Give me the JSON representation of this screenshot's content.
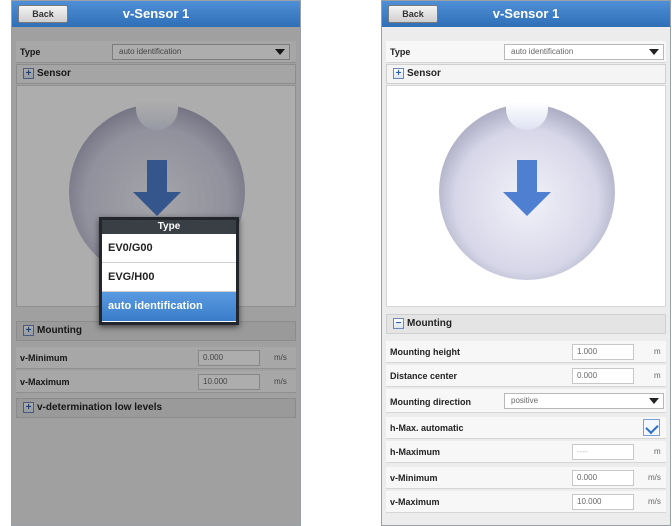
{
  "left": {
    "back_label": "Back",
    "title": "v-Sensor 1",
    "type_label": "Type",
    "type_value": "auto identification",
    "sensor_section": "Sensor",
    "mounting_section": "Mounting",
    "vmin_label": "v-Minimum",
    "vmin_value": "0.000",
    "vmin_unit": "m/s",
    "vmax_label": "v-Maximum",
    "vmax_value": "10.000",
    "vmax_unit": "m/s",
    "vlow_section": "v-determination low levels",
    "popup": {
      "title": "Type",
      "options": [
        "EV0/G00",
        "EVG/H00",
        "auto identification"
      ]
    }
  },
  "right": {
    "back_label": "Back",
    "title": "v-Sensor 1",
    "type_label": "Type",
    "type_value": "auto identification",
    "sensor_section": "Sensor",
    "mounting_section": "Mounting",
    "mounting_height_label": "Mounting height",
    "mounting_height_value": "1.000",
    "mounting_height_unit": "m",
    "distance_center_label": "Distance center",
    "distance_center_value": "0.000",
    "distance_center_unit": "m",
    "mounting_direction_label": "Mounting direction",
    "mounting_direction_value": "positive",
    "hmax_auto_label": "h-Max. automatic",
    "hmax_auto_checked": true,
    "hmax_label": "h-Maximum",
    "hmax_value": "----",
    "hmax_unit": "m",
    "vmin_label": "v-Minimum",
    "vmin_value": "0.000",
    "vmin_unit": "m/s",
    "vmax_label": "v-Maximum",
    "vmax_value": "10.000",
    "vmax_unit": "m/s"
  },
  "colors": {
    "header_blue": "#3a7cc8",
    "arrow_blue": "#4f7fd0",
    "selected_blue": "#4a8bd8"
  }
}
